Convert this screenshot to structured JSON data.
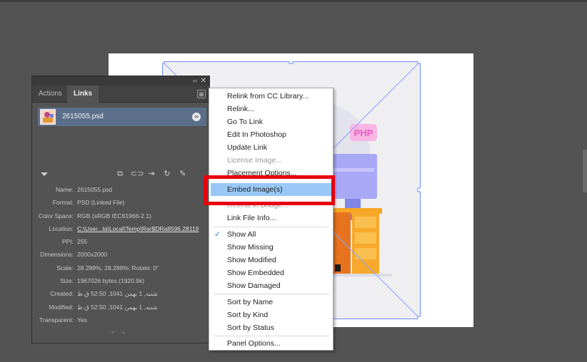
{
  "panel": {
    "tabs": [
      "Actions",
      "Links"
    ],
    "active_tab": "Links",
    "link": {
      "filename": "2615055.psd"
    },
    "info": [
      {
        "label": "Name:",
        "value": "2615055.psd"
      },
      {
        "label": "Format:",
        "value": "PSD (Linked File)"
      },
      {
        "label": "Color Space:",
        "value": "RGB (sRGB IEC61966-2.1)"
      },
      {
        "label": "Location:",
        "value": "C:\\User...ta\\Local\\Temp\\Rar$DRa8596.28119"
      },
      {
        "label": "PPI:",
        "value": "255"
      },
      {
        "label": "Dimensions:",
        "value": "2000x2000"
      },
      {
        "label": "Scale:",
        "value": "28.289%, 28.289%; Rotate: 0°"
      },
      {
        "label": "Size:",
        "value": "1967026 bytes (1920.9k)"
      },
      {
        "label": "Created:",
        "value": "شنبه, 1 بهمن 1041, 52:50 ق.ظ"
      },
      {
        "label": "Modified:",
        "value": "شنبه, 1 بهمن 1041, 52:50 ق.ظ"
      },
      {
        "label": "Transparent:",
        "value": "Yes"
      }
    ],
    "icons": [
      "relink-cc-icon",
      "relink-icon",
      "go-to-link-icon",
      "update-link-icon",
      "edit-original-icon"
    ]
  },
  "menu": {
    "items": [
      {
        "label": "Relink from CC Library...",
        "state": "normal"
      },
      {
        "label": "Relink...",
        "state": "normal"
      },
      {
        "label": "Go To Link",
        "state": "normal"
      },
      {
        "label": "Edit In Photoshop",
        "state": "normal"
      },
      {
        "label": "Update Link",
        "state": "normal"
      },
      {
        "label": "License Image...",
        "state": "disabled"
      },
      {
        "label": "Placement Options...",
        "state": "normal"
      },
      {
        "label": "Embed Image(s)",
        "state": "highlighted"
      },
      {
        "label": "Reveal in Bridge...",
        "state": "disabled"
      },
      {
        "label": "Link File Info...",
        "state": "normal"
      },
      {
        "label": "Show All",
        "state": "checked"
      },
      {
        "label": "Show Missing",
        "state": "normal"
      },
      {
        "label": "Show Modified",
        "state": "normal"
      },
      {
        "label": "Show Embedded",
        "state": "normal"
      },
      {
        "label": "Show Damaged",
        "state": "normal"
      },
      {
        "label": "Sort by Name",
        "state": "normal"
      },
      {
        "label": "Sort by Kind",
        "state": "normal"
      },
      {
        "label": "Sort by Status",
        "state": "normal"
      },
      {
        "label": "Panel Options...",
        "state": "normal"
      }
    ]
  },
  "artwork": {
    "badge_text": "PHP"
  },
  "colors": {
    "highlight": "#99c8f7",
    "annotation": "#e8000b",
    "selection": "#6b8cff",
    "panel_bg": "#535353",
    "canvas_bg": "#535353"
  }
}
